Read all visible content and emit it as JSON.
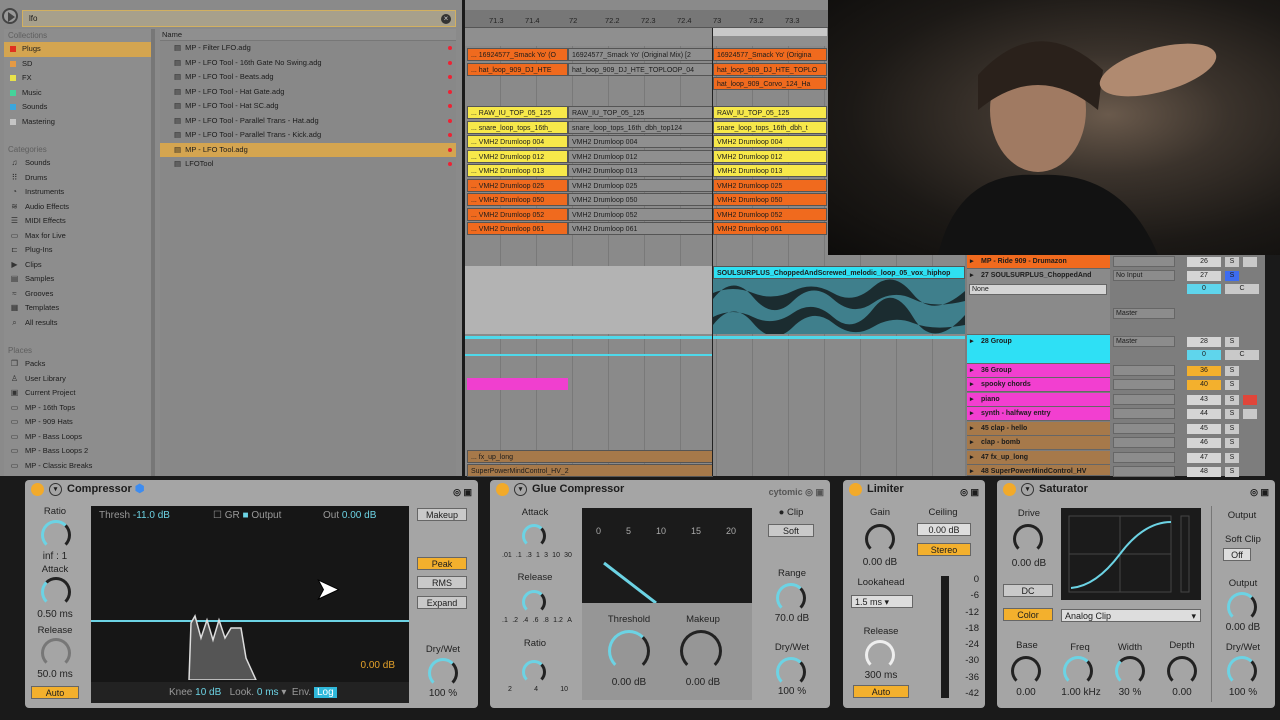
{
  "browser": {
    "search_value": "lfo",
    "collections_header": "Collections",
    "collections": [
      {
        "label": "Plugs",
        "color": "#e0311f"
      },
      {
        "label": "SD",
        "color": "#e59a45"
      },
      {
        "label": "FX",
        "color": "#e8e24a"
      },
      {
        "label": "Music",
        "color": "#45d39a"
      },
      {
        "label": "Sounds",
        "color": "#3ba6dc"
      },
      {
        "label": "Mastering",
        "color": "#c5c5c5"
      }
    ],
    "categories_header": "Categories",
    "categories": [
      {
        "label": "Sounds",
        "icon": "♫"
      },
      {
        "label": "Drums",
        "icon": "⠿"
      },
      {
        "label": "Instruments",
        "icon": "◔"
      },
      {
        "label": "Audio Effects",
        "icon": "≋"
      },
      {
        "label": "MIDI Effects",
        "icon": "☰"
      },
      {
        "label": "Max for Live",
        "icon": "▭"
      },
      {
        "label": "Plug-Ins",
        "icon": "⊏"
      },
      {
        "label": "Clips",
        "icon": "▶"
      },
      {
        "label": "Samples",
        "icon": "▤"
      },
      {
        "label": "Grooves",
        "icon": "≈"
      },
      {
        "label": "Templates",
        "icon": "▦"
      },
      {
        "label": "All results",
        "icon": "⌕"
      }
    ],
    "places_header": "Places",
    "places": [
      {
        "label": "Packs",
        "icon": "❒"
      },
      {
        "label": "User Library",
        "icon": "♙"
      },
      {
        "label": "Current Project",
        "icon": "▣"
      },
      {
        "label": "MP - 16th Tops",
        "icon": "▭"
      },
      {
        "label": "MP - 909 Hats",
        "icon": "▭"
      },
      {
        "label": "MP - Bass Loops",
        "icon": "▭"
      },
      {
        "label": "MP - Bass Loops 2",
        "icon": "▭"
      },
      {
        "label": "MP - Classic Breaks",
        "icon": "▭"
      }
    ],
    "name_header": "Name",
    "files": [
      "MP - Filter LFO.adg",
      "MP - LFO Tool - 16th Gate No Swing.adg",
      "MP - LFO Tool - Beats.adg",
      "MP - LFO Tool - Hat Gate.adg",
      "MP - LFO Tool - Hat SC.adg",
      "MP - LFO Tool - Parallel Trans - Hat.adg",
      "MP - LFO Tool - Parallel Trans - Kick.adg",
      "MP - LFO Tool.adg",
      "LFOTool"
    ],
    "selected_file": 7
  },
  "arrangement": {
    "ruler": [
      "71.3",
      "71.4",
      "72",
      "72.2",
      "72.3",
      "72.4",
      "73",
      "73.2",
      "73.3"
    ],
    "rows": [
      {
        "clips": [
          "... 16924577_Smack Yo' (O",
          "16924577_Smack Yo' (Original Mix) [2",
          "16924577_Smack Yo' (Origina"
        ],
        "color": "#f06a1e"
      },
      {
        "clips": [
          "... hat_loop_909_DJ_HTE",
          "hat_loop_909_DJ_HTE_TOPLOOP_04",
          "hat_loop_909_DJ_HTE_TOPLO"
        ],
        "color": "#f06a1e"
      },
      {
        "clips": [
          "",
          "",
          "hat_loop_909_Corvo_124_Ha"
        ],
        "color": "#f06a1e"
      },
      {
        "clips": [
          "",
          "",
          ""
        ],
        "color": "#f06a1e"
      },
      {
        "clips": [
          "... RAW_IU_TOP_05_125",
          "RAW_IU_TOP_05_125",
          "RAW_IU_TOP_05_125"
        ],
        "color": "#f7e84a"
      },
      {
        "clips": [
          "... snare_loop_tops_16th_",
          "snare_loop_tops_16th_dbh_top124",
          "snare_loop_tops_16th_dbh_t"
        ],
        "color": "#f7e84a"
      },
      {
        "clips": [
          "... VMH2 Drumloop 004",
          "VMH2 Drumloop 004",
          "VMH2 Drumloop 004"
        ],
        "color": "#f7e84a"
      },
      {
        "clips": [
          "... VMH2 Drumloop 012",
          "VMH2 Drumloop 012",
          "VMH2 Drumloop 012"
        ],
        "color": "#f7e84a"
      },
      {
        "clips": [
          "... VMH2 Drumloop 013",
          "VMH2 Drumloop 013",
          "VMH2 Drumloop 013"
        ],
        "color": "#f7e84a"
      },
      {
        "clips": [
          "... VMH2 Drumloop 025",
          "VMH2 Drumloop 025",
          "VMH2 Drumloop 025"
        ],
        "color": "#f06a1e"
      },
      {
        "clips": [
          "... VMH2 Drumloop 050",
          "VMH2 Drumloop 050",
          "VMH2 Drumloop 050"
        ],
        "color": "#f06a1e"
      },
      {
        "clips": [
          "... VMH2 Drumloop 052",
          "VMH2 Drumloop 052",
          "VMH2 Drumloop 052"
        ],
        "color": "#f06a1e"
      },
      {
        "clips": [
          "... VMH2 Drumloop 061",
          "VMH2 Drumloop 061",
          "VMH2 Drumloop 061"
        ],
        "color": "#f06a1e"
      }
    ],
    "audio_clip": "SOULSURPLUS_ChoppedAndScrewed_melodic_loop_05_vox_hiphop",
    "fx_clip": "... fx_up_long",
    "super_clip": "SuperPowerMindControl_HV_2"
  },
  "mixer": {
    "tracks": [
      {
        "name": "MP - Ride 909 - Drumazon",
        "color": "#f06a1e",
        "num": "26",
        "top": 0
      },
      {
        "name": "27 SOULSURPLUS_ChoppedAnd",
        "color": "#8a8a8a",
        "num": "27",
        "input": "No Input",
        "sub": "None",
        "output": "Master"
      },
      {
        "name": "28 Group",
        "color": "#2ee0f5",
        "num": "28",
        "output": "Master"
      },
      {
        "name": "36 Group",
        "color": "#f23fd0",
        "num": "36"
      },
      {
        "name": "spooky chords",
        "color": "#f23fd0",
        "num": "40"
      },
      {
        "name": "piano",
        "color": "#f23fd0",
        "num": "43"
      },
      {
        "name": "synth - halfway entry",
        "color": "#f23fd0",
        "num": "44"
      },
      {
        "name": "45 clap - hello",
        "color": "#a6794a",
        "num": "45"
      },
      {
        "name": "clap - bomb",
        "color": "#a6794a",
        "num": "46"
      },
      {
        "name": "47 fx_up_long",
        "color": "#a6794a",
        "num": "47"
      },
      {
        "name": "48 SuperPowerMindControl_HV",
        "color": "#a6794a",
        "num": "48"
      }
    ],
    "solo": "S",
    "cue": "C",
    "pan": "0"
  },
  "compressor": {
    "title": "Compressor",
    "ratio_label": "Ratio",
    "ratio": "inf : 1",
    "attack_label": "Attack",
    "attack": "0.50 ms",
    "release_label": "Release",
    "release": "50.0 ms",
    "auto": "Auto",
    "thresh_label": "Thresh",
    "thresh": "-11.0 dB",
    "gr": "GR",
    "output": "Output",
    "out_label": "Out",
    "out": "0.00 dB",
    "gr_readout": "0.00 dB",
    "knee_label": "Knee",
    "knee": "10 dB",
    "look_label": "Look.",
    "look": "0 ms",
    "env_label": "Env.",
    "env": "Log",
    "makeup": "Makeup",
    "peak": "Peak",
    "rms": "RMS",
    "expand": "Expand",
    "drywet_label": "Dry/Wet",
    "drywet": "100 %"
  },
  "glue": {
    "title": "Glue Compressor",
    "brand": "cytomic",
    "attack_label": "Attack",
    "attack_scale": [
      ".01",
      ".1",
      ".3",
      "1",
      "3",
      "10",
      "30"
    ],
    "release_label": "Release",
    "release_scale": [
      ".1",
      ".2",
      ".4",
      ".6",
      ".8",
      "1.2",
      "A"
    ],
    "ratio_label": "Ratio",
    "ratio_scale": [
      "2",
      "4",
      "10"
    ],
    "meter_scale": [
      "0",
      "5",
      "10",
      "15",
      "20"
    ],
    "threshold_label": "Threshold",
    "threshold": "0.00 dB",
    "makeup_label": "Makeup",
    "makeup": "0.00 dB",
    "clip_label": "Clip",
    "clip": "Soft",
    "range_label": "Range",
    "range": "70.0 dB",
    "drywet_label": "Dry/Wet",
    "drywet": "100 %"
  },
  "limiter": {
    "title": "Limiter",
    "gain_label": "Gain",
    "gain": "0.00 dB",
    "ceiling_label": "Ceiling",
    "ceiling": "0.00 dB",
    "stereo": "Stereo",
    "lookahead_label": "Lookahead",
    "lookahead": "1.5 ms",
    "release_label": "Release",
    "release": "300 ms",
    "auto": "Auto",
    "meter_scale": [
      "0",
      "-6",
      "-12",
      "-18",
      "-24",
      "-30",
      "-36",
      "-42"
    ]
  },
  "saturator": {
    "title": "Saturator",
    "drive_label": "Drive",
    "drive": "0.00 dB",
    "dc": "DC",
    "color": "Color",
    "mode": "Analog Clip",
    "base_label": "Base",
    "base": "0.00",
    "freq_label": "Freq",
    "freq": "1.00 kHz",
    "width_label": "Width",
    "width": "30 %",
    "depth_label": "Depth",
    "depth": "0.00",
    "output_header": "Output",
    "softclip_label": "Soft Clip",
    "softclip": "Off",
    "output_label": "Output",
    "output": "0.00 dB",
    "drywet_label": "Dry/Wet",
    "drywet": "100 %"
  }
}
